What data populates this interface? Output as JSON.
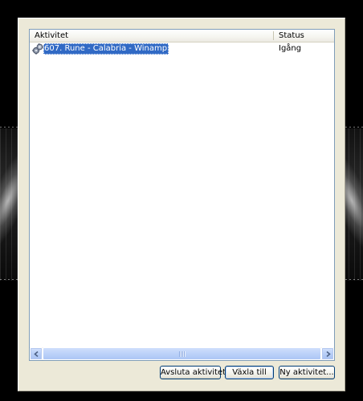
{
  "listview": {
    "columns": [
      "Aktivitet",
      "Status"
    ],
    "rows": [
      {
        "name": "607. Rune - Calabria - Winamp",
        "status": "Igång",
        "selected": true,
        "icon": "gears-icon"
      }
    ]
  },
  "buttons": {
    "end_task": "Avsluta aktivitet",
    "switch_to": "Växla till",
    "new_task": "Ny aktivitet..."
  },
  "colors": {
    "selection": "#316ac5",
    "dialog_bg": "#ece9d8",
    "list_border": "#7f9db9"
  }
}
